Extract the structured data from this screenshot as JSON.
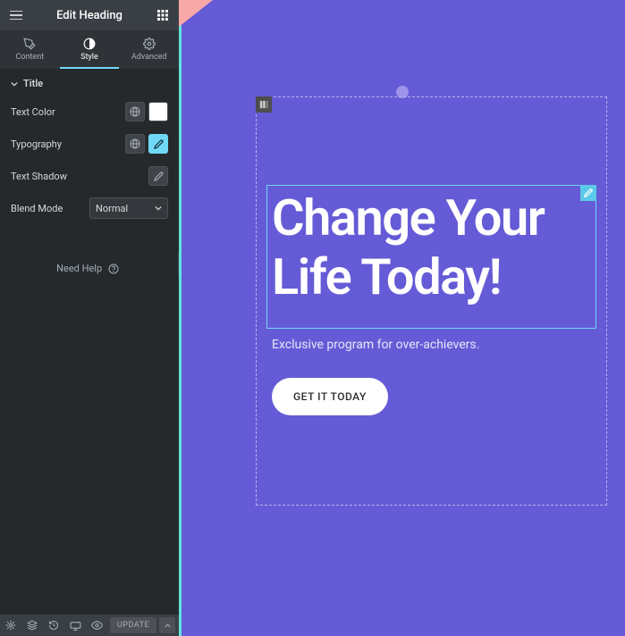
{
  "header": {
    "title": "Edit Heading"
  },
  "tabs": [
    {
      "label": "Content",
      "active": false
    },
    {
      "label": "Style",
      "active": true
    },
    {
      "label": "Advanced",
      "active": false
    }
  ],
  "section": {
    "title": "Title"
  },
  "controls": {
    "textColor": {
      "label": "Text Color",
      "swatch": "#ffffff"
    },
    "typography": {
      "label": "Typography"
    },
    "textShadow": {
      "label": "Text Shadow"
    },
    "blendMode": {
      "label": "Blend Mode",
      "value": "Normal"
    }
  },
  "help": {
    "text": "Need Help"
  },
  "footer": {
    "update": "UPDATE"
  },
  "canvas": {
    "heading": "Change Your Life Today!",
    "subtext": "Exclusive program for over-achievers.",
    "button": "GET IT TODAY"
  }
}
